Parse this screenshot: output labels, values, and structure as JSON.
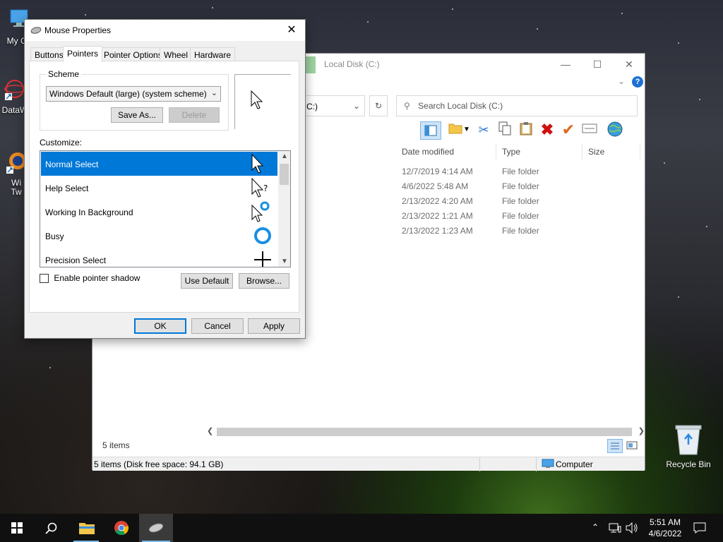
{
  "desktop": {
    "icons": [
      {
        "label": "My Co",
        "icon": "this-pc-icon"
      },
      {
        "label": "DataW",
        "icon": "datawrapper-icon"
      },
      {
        "label": "Wi\nTw",
        "icon": "app-shortcut-icon"
      },
      {
        "label": "Recycle Bin",
        "icon": "recycle-bin-icon"
      }
    ]
  },
  "explorer": {
    "title": "Local Disk (C:)",
    "address_tail": "C:)",
    "search_placeholder": "Search Local Disk (C:)",
    "columns": [
      "Date modified",
      "Type",
      "Size"
    ],
    "rows": [
      {
        "date": "12/7/2019 4:14 AM",
        "type": "File folder"
      },
      {
        "date": "4/6/2022 5:48 AM",
        "type": "File folder"
      },
      {
        "date": "2/13/2022 4:20 AM",
        "type": "File folder"
      },
      {
        "date": "2/13/2022 1:21 AM",
        "type": "File folder"
      },
      {
        "date": "2/13/2022 1:23 AM",
        "type": "File folder"
      }
    ],
    "item_count": "5 items",
    "status": "5 items (Disk free space: 94.1 GB)",
    "location": "Computer",
    "accent": "#0078d7"
  },
  "dialog": {
    "title": "Mouse Properties",
    "tabs": [
      "Buttons",
      "Pointers",
      "Pointer Options",
      "Wheel",
      "Hardware"
    ],
    "active_tab": 1,
    "scheme_label": "Scheme",
    "scheme_value": "Windows Default (large) (system scheme)",
    "save_as": "Save As...",
    "delete": "Delete",
    "customize_label": "Customize:",
    "pointers": [
      {
        "label": "Normal Select",
        "icon": "arrow-cursor-icon"
      },
      {
        "label": "Help Select",
        "icon": "help-cursor-icon"
      },
      {
        "label": "Working In Background",
        "icon": "working-cursor-icon"
      },
      {
        "label": "Busy",
        "icon": "busy-cursor-icon"
      },
      {
        "label": "Precision Select",
        "icon": "crosshair-cursor-icon"
      }
    ],
    "selected_pointer": 0,
    "shadow_label": "Enable pointer shadow",
    "use_default": "Use Default",
    "browse": "Browse...",
    "ok": "OK",
    "cancel": "Cancel",
    "apply": "Apply"
  },
  "taskbar": {
    "time": "5:51 AM",
    "date": "4/6/2022"
  }
}
